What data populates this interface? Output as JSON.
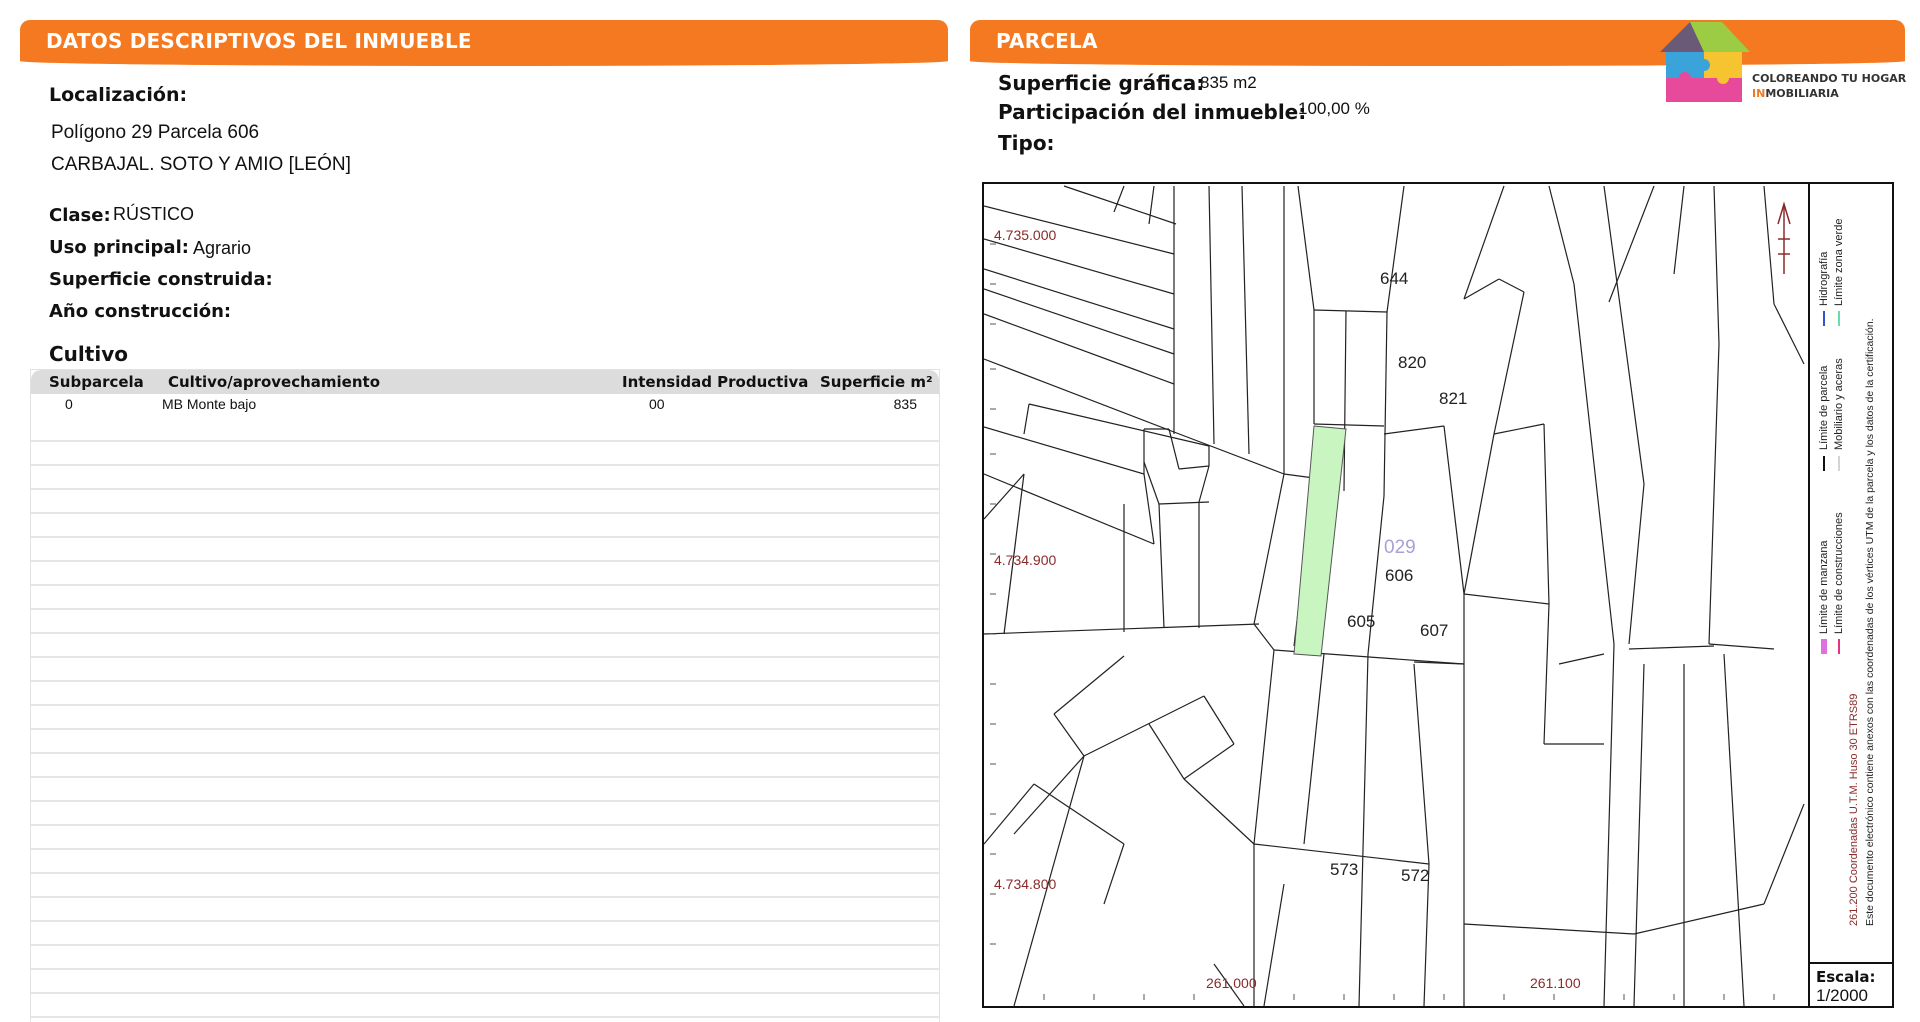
{
  "left_section": {
    "title_prefix": "DATOS DESCRIPTIVOS DEL ",
    "title_emphasis": "INMUEBLE",
    "localizacion_label": "Localización:",
    "localizacion_line1": "Polígono 29 Parcela 606",
    "localizacion_line2": "CARBAJAL. SOTO Y AMIO [LEÓN]",
    "clase_label": "Clase:",
    "clase_value": "RÚSTICO",
    "uso_label": "Uso principal:",
    "uso_value": "Agrario",
    "superficie_label": "Superficie construida:",
    "anio_label": "Año construcción:",
    "cultivo_label": "Cultivo"
  },
  "cultivo_table": {
    "headers": [
      "Subparcela",
      "Cultivo/aprovechamiento",
      "Intensidad Productiva",
      "Superficie m²"
    ],
    "rows": [
      {
        "subparcela": "0",
        "cultivo": "MB Monte bajo",
        "intensidad": "00",
        "superficie": "835"
      }
    ]
  },
  "right_section": {
    "title": "PARCELA",
    "superficie_grafica_label": "Superficie gráfica:",
    "superficie_grafica_value": "835 m2",
    "participacion_label": "Participación del inmueble:",
    "participacion_value": "100,00 %",
    "tipo_label": "Tipo:"
  },
  "logo": {
    "line1": "COLOREANDO TU HOGAR",
    "line2_accent": "IN",
    "line2_rest": "MOBILIARIA"
  },
  "map": {
    "coords": {
      "y1": "4.735.000",
      "y2": "4.734.900",
      "y3": "4.734.800",
      "x1": "261.000",
      "x2": "261.100"
    },
    "parcels": {
      "p644": "644",
      "p820": "820",
      "p821": "821",
      "p029": "029",
      "p606": "606",
      "p605": "605",
      "p607": "607",
      "p573": "573",
      "p572": "572"
    },
    "legend": {
      "manzana": "Límite de manzana",
      "construcciones": "Límite de construcciones",
      "parcela": "Límite de parcela",
      "mobiliario": "Mobiliario y aceras",
      "hidrografia": "Hidrografía",
      "zona_verde": "Límite zona verde",
      "coordenadas": "261.200 Coordenadas U.T.M. Huso 30 ETRS89",
      "documento": "Este documento electrónico contiene anexos con las coordenadas de los vértices UTM de la parcela y los datos de la certificación."
    },
    "scale_label": "Escala:",
    "scale_value": "1/2000",
    "highlight_color": "#c8f5c0"
  }
}
